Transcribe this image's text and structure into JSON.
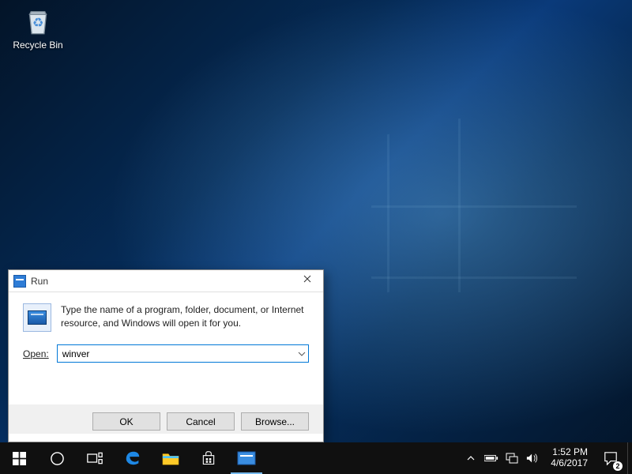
{
  "desktop": {
    "recycle_bin_label": "Recycle Bin"
  },
  "run_dialog": {
    "title": "Run",
    "instruction": "Type the name of a program, folder, document, or Internet resource, and Windows will open it for you.",
    "open_label": "Open:",
    "open_value": "winver",
    "buttons": {
      "ok": "OK",
      "cancel": "Cancel",
      "browse": "Browse..."
    }
  },
  "taskbar": {
    "clock_time": "1:52 PM",
    "clock_date": "4/6/2017",
    "notification_count": "2"
  }
}
